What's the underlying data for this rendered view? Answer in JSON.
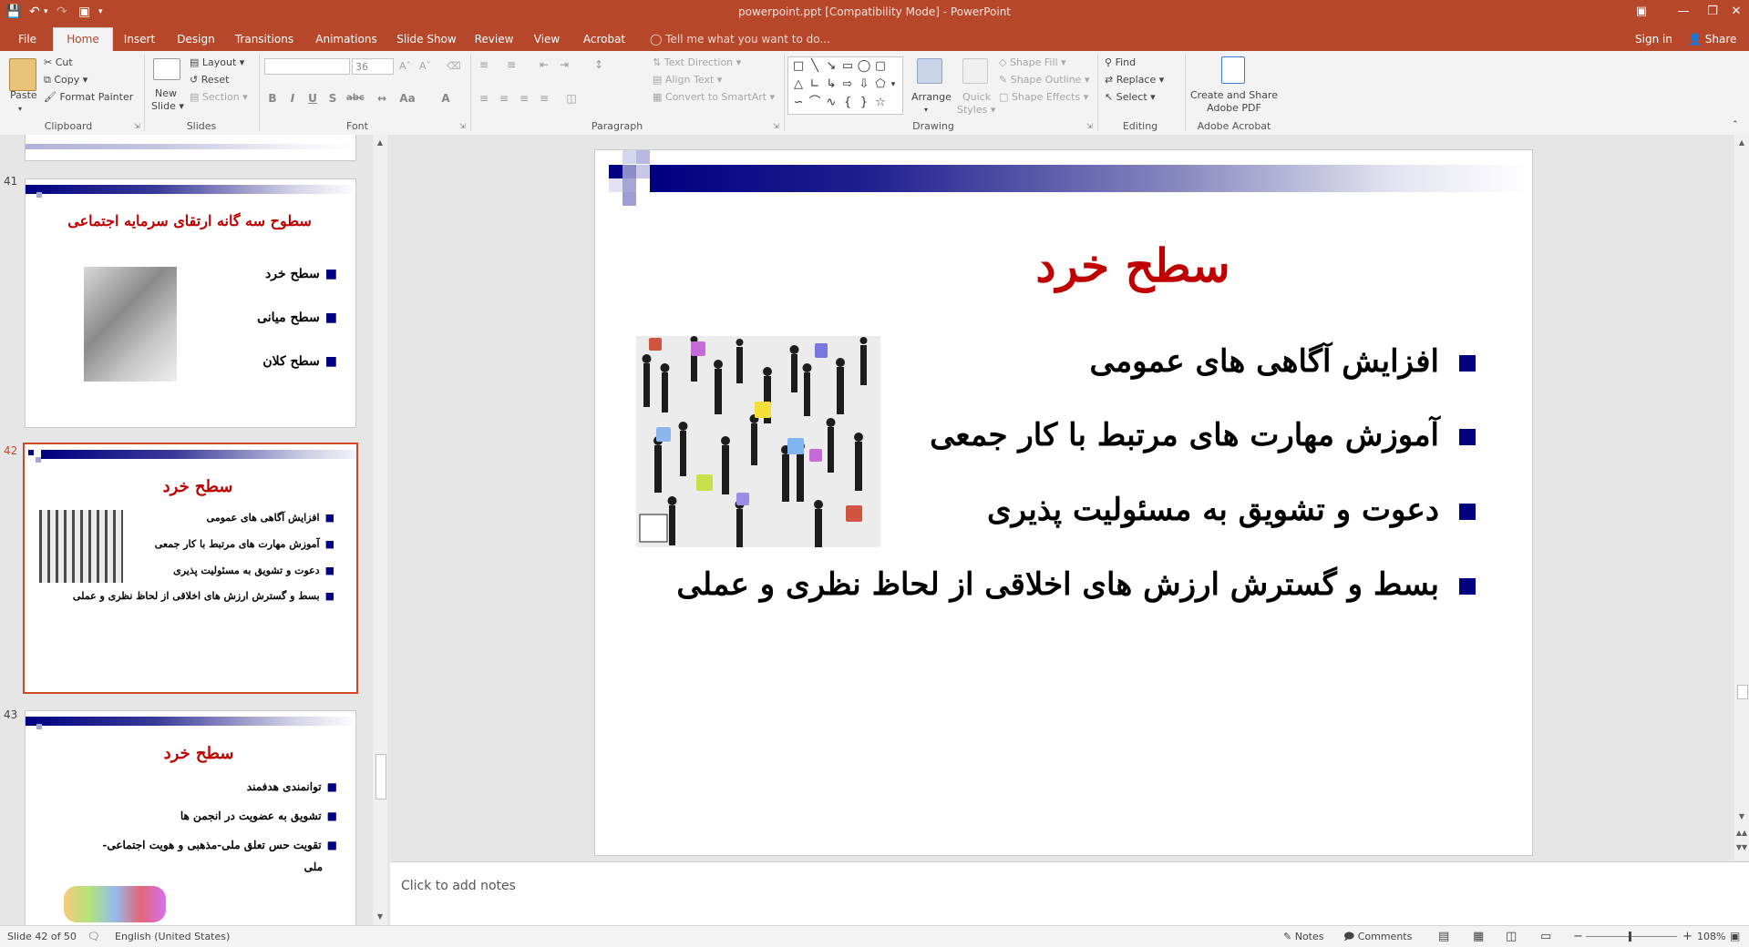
{
  "window": {
    "title": "powerpoint.ppt [Compatibility Mode] - PowerPoint",
    "controls": [
      "restore",
      "minimize",
      "maximize",
      "close"
    ]
  },
  "quick_access": [
    "save-icon",
    "undo-icon",
    "redo-icon",
    "start-from-beginning-icon",
    "customize-icon"
  ],
  "tabs": [
    {
      "label": "File"
    },
    {
      "label": "Home",
      "active": true
    },
    {
      "label": "Insert"
    },
    {
      "label": "Design"
    },
    {
      "label": "Transitions"
    },
    {
      "label": "Animations"
    },
    {
      "label": "Slide Show"
    },
    {
      "label": "Review"
    },
    {
      "label": "View"
    },
    {
      "label": "Acrobat"
    }
  ],
  "tell_me": "Tell me what you want to do...",
  "account": {
    "sign_in": "Sign in",
    "share": "Share"
  },
  "ribbon": {
    "clipboard": {
      "paste": "Paste",
      "cut": "Cut",
      "copy": "Copy",
      "format_painter": "Format Painter",
      "label": "Clipboard"
    },
    "slides": {
      "new_slide_1": "New",
      "new_slide_2": "Slide",
      "layout": "Layout",
      "reset": "Reset",
      "section": "Section",
      "label": "Slides"
    },
    "font": {
      "font_name": "",
      "font_size": "36",
      "bold": "B",
      "italic": "I",
      "underline": "U",
      "shadow": "S",
      "strike": "abc",
      "label": "Font"
    },
    "paragraph": {
      "text_direction": "Text Direction",
      "align_text": "Align Text",
      "convert": "Convert to SmartArt",
      "label": "Paragraph"
    },
    "drawing": {
      "arrange": "Arrange",
      "quick_styles_1": "Quick",
      "quick_styles_2": "Styles",
      "shape_fill": "Shape Fill",
      "shape_outline": "Shape Outline",
      "shape_effects": "Shape Effects",
      "label": "Drawing"
    },
    "editing": {
      "find": "Find",
      "replace": "Replace",
      "select": "Select",
      "label": "Editing"
    },
    "acrobat": {
      "create_1": "Create and Share",
      "create_2": "Adobe PDF",
      "label": "Adobe Acrobat"
    }
  },
  "thumbnails": [
    {
      "number": "41",
      "title": "سطوح سه گانه ارتقای سرمایه اجتماعی",
      "bullets": [
        "سطح خرد",
        "سطح میانی",
        "سطح کلان"
      ]
    },
    {
      "number": "42",
      "selected": true,
      "title": "سطح خرد",
      "bullets": [
        "افزایش آگاهی های عمومی",
        "آموزش مهارت های مرتبط با کار جمعی",
        "دعوت و تشویق به مسئولیت پذیری",
        "بسط و گسترش ارزش های اخلاقی از لحاظ نظری و عملی"
      ]
    },
    {
      "number": "43",
      "title": "سطح خرد",
      "bullets": [
        "توانمندی هدفمند",
        "تشویق به عضویت در انجمن ها",
        "تقویت حس تعلق ملی-مذهبی و هویت اجتماعی-",
        "ملی"
      ]
    }
  ],
  "slide": {
    "title": "سطح خرد",
    "bullets": [
      "افزایش آگاهی های عمومی",
      "آموزش مهارت های مرتبط با کار جمعی",
      "دعوت و تشویق به مسئولیت پذیری",
      "بسط و گسترش ارزش های اخلاقی از لحاظ نظری و  عملی"
    ],
    "colors": {
      "title": "#c00000",
      "bullet": "#000080",
      "text": "#000000"
    }
  },
  "notes_placeholder": "Click to add notes",
  "status": {
    "slide_counter": "Slide 42 of 50",
    "language": "English (United States)",
    "notes": "Notes",
    "comments": "Comments",
    "zoom": "108%"
  },
  "colors": {
    "accent": "#b7472a",
    "selection": "#d24726"
  }
}
